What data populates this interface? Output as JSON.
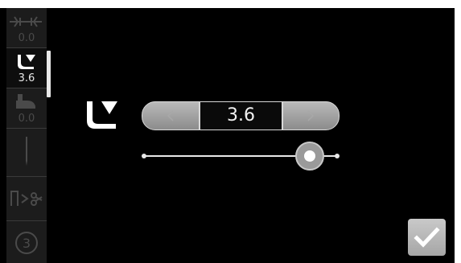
{
  "sidebar": {
    "items": [
      {
        "icon": "stitch-width-icon",
        "value": "0.0",
        "active": false
      },
      {
        "icon": "presser-foot-height-icon",
        "value": "3.6",
        "active": true
      },
      {
        "icon": "presser-foot-pressure-icon",
        "value": "0.0",
        "active": false
      },
      {
        "icon": "needle-icon",
        "value": "",
        "active": false
      },
      {
        "icon": "thread-cut-icon",
        "value": "",
        "active": false
      },
      {
        "icon": "step-three-icon",
        "value": "",
        "active": false
      }
    ]
  },
  "main": {
    "setting_icon": "presser-foot-height-icon",
    "value": "3.6",
    "slider": {
      "value_fraction": 0.86
    }
  },
  "confirm": {
    "icon": "checkmark-icon"
  },
  "colors": {
    "background": "#000000",
    "sidebar": "#1c1c1c",
    "button": "#a6a6a6",
    "text": "#f2f2f2"
  }
}
